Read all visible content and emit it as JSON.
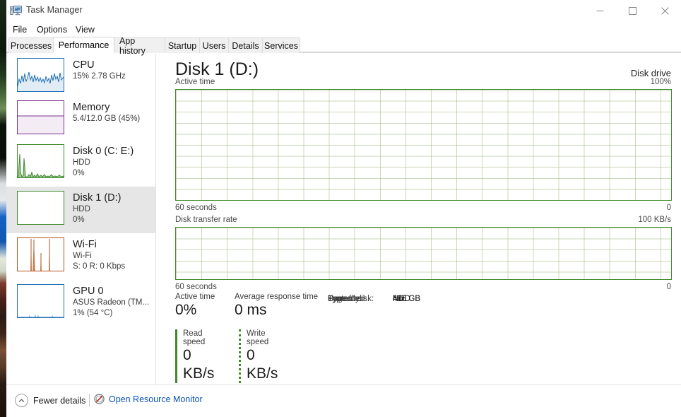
{
  "window": {
    "title": "Task Manager",
    "icon": "task-manager-icon",
    "controls": {
      "minimize": "–",
      "maximize": "□",
      "close": "✕"
    }
  },
  "menubar": {
    "items": [
      "File",
      "Options",
      "View"
    ]
  },
  "tabs": [
    {
      "label": "Processes",
      "active": false
    },
    {
      "label": "Performance",
      "active": true
    },
    {
      "label": "App history",
      "active": false
    },
    {
      "label": "Startup",
      "active": false
    },
    {
      "label": "Users",
      "active": false
    },
    {
      "label": "Details",
      "active": false
    },
    {
      "label": "Services",
      "active": false
    }
  ],
  "sidebar": {
    "items": [
      {
        "name": "cpu",
        "title": "CPU",
        "line1": "15% 2.78 GHz",
        "line2": "",
        "color": "#1f6fb5",
        "selected": false
      },
      {
        "name": "memory",
        "title": "Memory",
        "line1": "5.4/12.0 GB (45%)",
        "line2": "",
        "color": "#7a2f8f",
        "selected": false
      },
      {
        "name": "disk0",
        "title": "Disk 0 (C: E:)",
        "line1": "HDD",
        "line2": "0%",
        "color": "#3f8a2b",
        "selected": false
      },
      {
        "name": "disk1",
        "title": "Disk 1 (D:)",
        "line1": "HDD",
        "line2": "0%",
        "color": "#3f8a2b",
        "selected": true
      },
      {
        "name": "wifi",
        "title": "Wi-Fi",
        "line1": "Wi-Fi",
        "line2": "S: 0 R: 0 Kbps",
        "color": "#b3541e",
        "selected": false
      },
      {
        "name": "gpu0",
        "title": "GPU 0",
        "line1": "ASUS Radeon (TM...",
        "line2": "1%  (54 °C)",
        "color": "#1f6fb5",
        "selected": false
      }
    ]
  },
  "main": {
    "title": "Disk 1 (D:)",
    "subtitle": "Disk drive",
    "graph_active": {
      "caption": "Active time",
      "max_label": "100%",
      "time_label": "60 seconds",
      "min_label": "0"
    },
    "graph_rate": {
      "caption": "Disk transfer rate",
      "max_label": "100 KB/s",
      "time_label": "60 seconds",
      "min_label": "0"
    },
    "stats": {
      "active_time_label": "Active time",
      "active_time_value": "0%",
      "avg_response_label": "Average response time",
      "avg_response_value": "0 ms",
      "read_speed_label": "Read speed",
      "read_speed_value": "0 KB/s",
      "write_speed_label": "Write speed",
      "write_speed_value": "0 KB/s",
      "details": [
        {
          "key": "Capacity:",
          "value": "466 GB"
        },
        {
          "key": "Formatted:",
          "value": "466 GB"
        },
        {
          "key": "System disk:",
          "value": "No"
        },
        {
          "key": "Page file:",
          "value": "No"
        },
        {
          "key": "Type:",
          "value": "HDD"
        }
      ]
    }
  },
  "statusbar": {
    "fewer_details": "Fewer details",
    "open_resource_monitor": "Open Resource Monitor",
    "chevron_icon": "chevron-up-icon",
    "resmon_icon": "resource-monitor-icon"
  },
  "colors": {
    "graph_border": "#3f8a2b",
    "graph_grid": "#a0b982",
    "link": "#0a53b5",
    "selected_bg": "#e6e6e6"
  },
  "chart_data": [
    {
      "type": "line",
      "title": "Active time",
      "ylabel": "Active time",
      "xlabel": "60 seconds",
      "ylim": [
        0,
        100
      ],
      "y_max_label": "100%",
      "y_min_label": "0",
      "x": [
        0,
        60
      ],
      "values": [
        0,
        0
      ],
      "grid": true,
      "series": [
        {
          "name": "Active time",
          "values": [
            0,
            0
          ]
        }
      ]
    },
    {
      "type": "line",
      "title": "Disk transfer rate",
      "ylabel": "Disk transfer rate",
      "xlabel": "60 seconds",
      "ylim": [
        0,
        100
      ],
      "y_max_label": "100 KB/s",
      "y_min_label": "0",
      "x": [
        0,
        60
      ],
      "values": [
        0,
        0
      ],
      "grid": true,
      "series": [
        {
          "name": "Read speed",
          "values": [
            0,
            0
          ]
        },
        {
          "name": "Write speed",
          "values": [
            0,
            0
          ]
        }
      ]
    }
  ]
}
